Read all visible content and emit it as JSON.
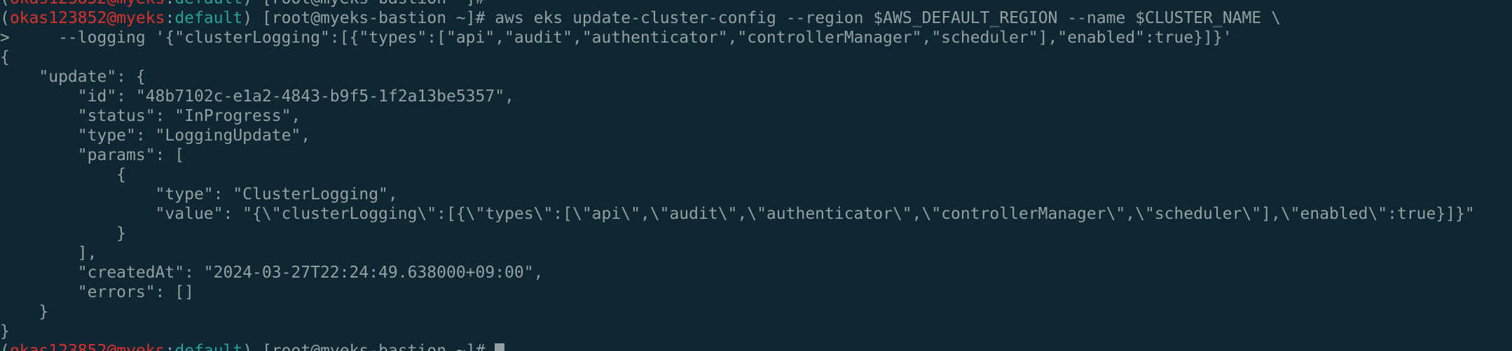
{
  "colors": {
    "background": "#0f2733",
    "text": "#93a1a1",
    "user": "#dc322f",
    "context": "#2aa198"
  },
  "prompt": {
    "open_paren": "(",
    "user": "okas123852",
    "at": "@",
    "host": "myeks",
    "colon": ":",
    "context": "default",
    "close_paren": ")",
    "shell": " [root@myeks-bastion ~]# "
  },
  "lines": {
    "l0_rest": "",
    "l1_cmd": "aws eks update-cluster-config --region $AWS_DEFAULT_REGION --name $CLUSTER_NAME \\",
    "l2": ">     --logging '{\"clusterLogging\":[{\"types\":[\"api\",\"audit\",\"authenticator\",\"controllerManager\",\"scheduler\"],\"enabled\":true}]}'",
    "l3": "{",
    "l4": "    \"update\": {",
    "l5": "        \"id\": \"48b7102c-e1a2-4843-b9f5-1f2a13be5357\",",
    "l6": "        \"status\": \"InProgress\",",
    "l7": "        \"type\": \"LoggingUpdate\",",
    "l8": "        \"params\": [",
    "l9": "            {",
    "l10": "                \"type\": \"ClusterLogging\",",
    "l11": "                \"value\": \"{\\\"clusterLogging\\\":[{\\\"types\\\":[\\\"api\\\",\\\"audit\\\",\\\"authenticator\\\",\\\"controllerManager\\\",\\\"scheduler\\\"],\\\"enabled\\\":true}]}\"",
    "l12": "            }",
    "l13": "        ],",
    "l14": "        \"createdAt\": \"2024-03-27T22:24:49.638000+09:00\",",
    "l15": "        \"errors\": []",
    "l16": "    }",
    "l17": "}"
  }
}
